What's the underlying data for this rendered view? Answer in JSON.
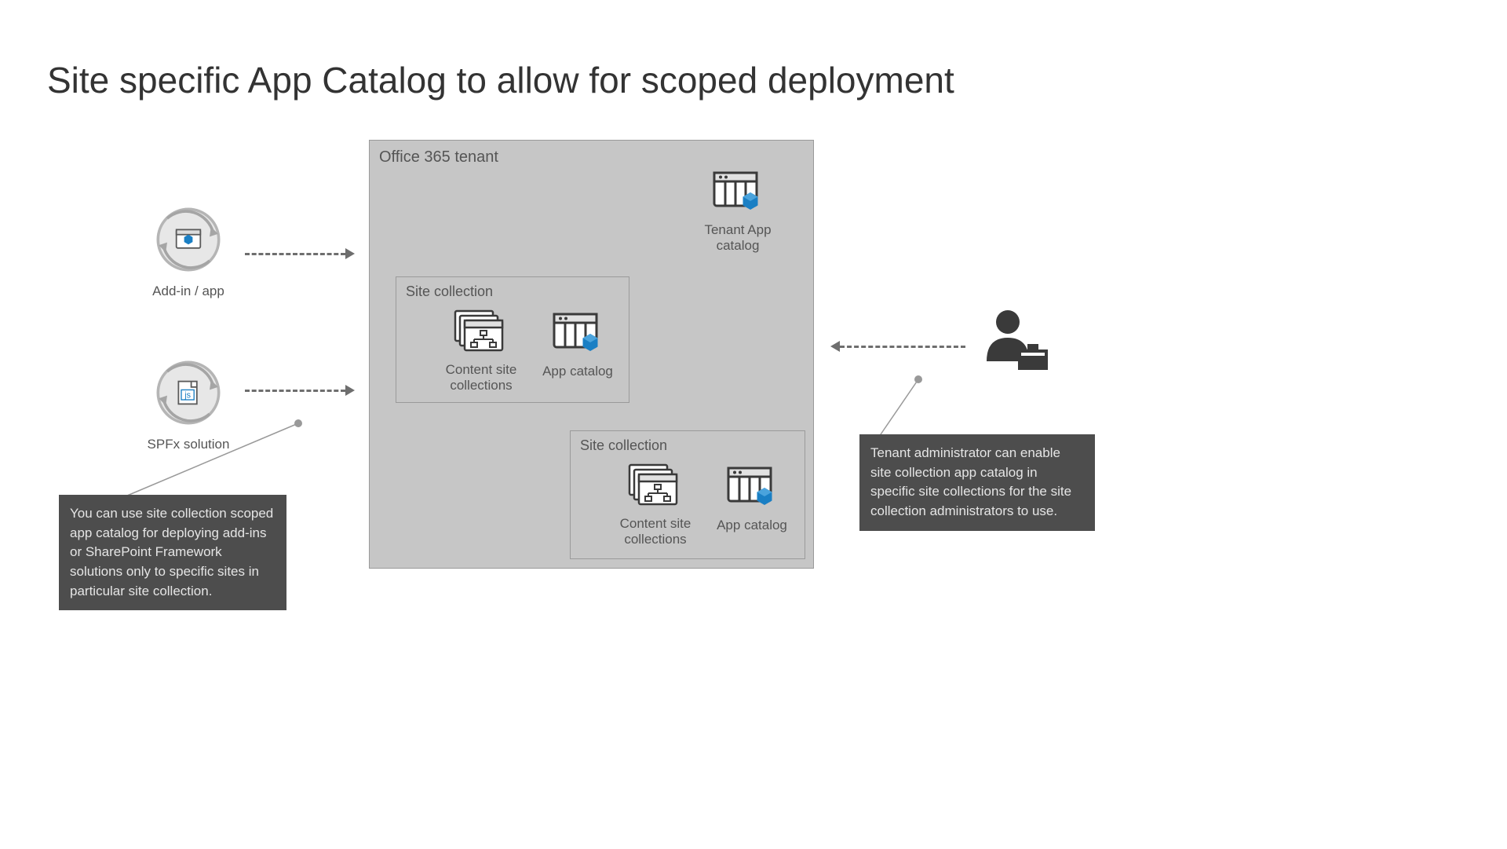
{
  "title": "Site specific App Catalog to allow for scoped deployment",
  "tenant_label": "Office 365 tenant",
  "addin_label": "Add-in / app",
  "spfx_label": "SPFx solution",
  "tenant_app_catalog_label": "Tenant App catalog",
  "sc_label": "Site collection",
  "csc_label": "Content site collections",
  "app_catalog_label": "App catalog",
  "callout_left": "You can use site collection scoped app catalog for deploying add-ins or SharePoint Framework solutions only to specific sites in particular site collection.",
  "callout_right": "Tenant administrator can enable site collection app catalog in specific site collections for the site collection administrators to use.",
  "colors": {
    "accent": "#1a7fc4",
    "panel": "#c6c6c6",
    "arrow": "#6e6e6e",
    "callout_bg": "#4d4d4d"
  }
}
